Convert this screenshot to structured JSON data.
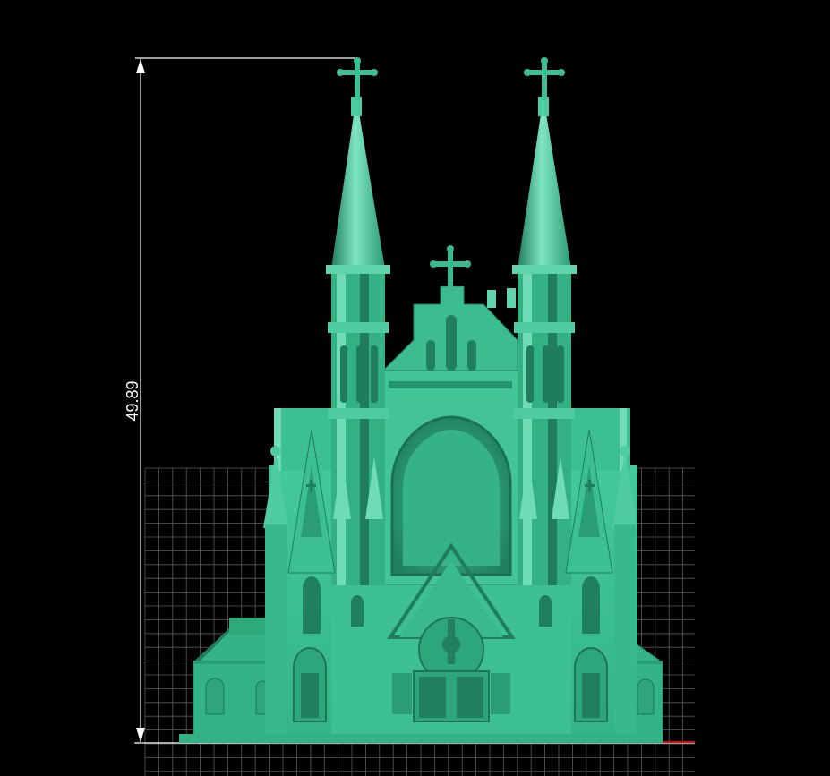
{
  "viewer": {
    "background_color": "#000000",
    "grid_color": "#5a5a5a",
    "model_color": "#3ec296",
    "model_dark": "#228a66",
    "model_light": "#7ee8c4"
  },
  "dimension": {
    "height_value": "49.89"
  }
}
